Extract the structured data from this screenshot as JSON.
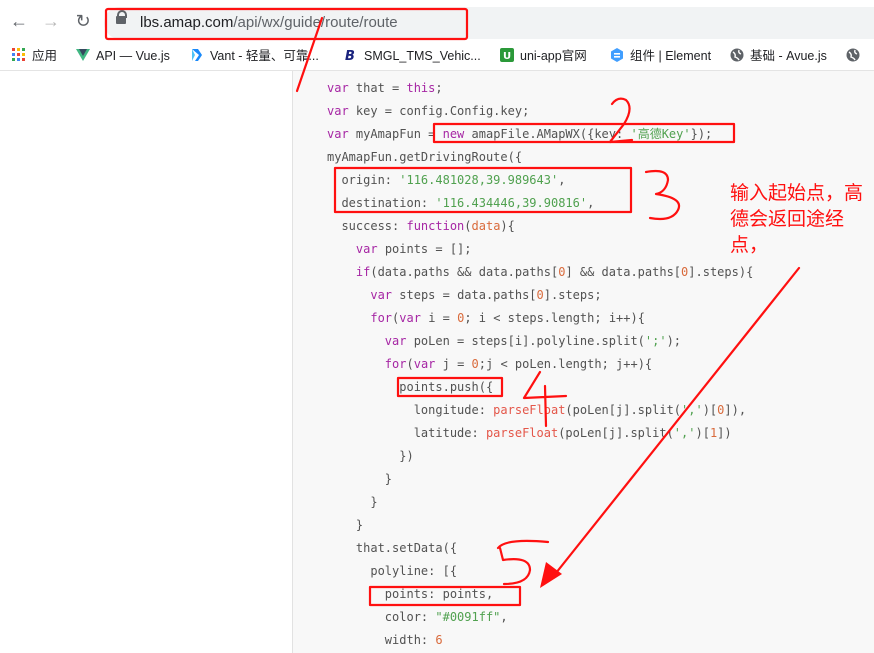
{
  "browser": {
    "url_host": "lbs.amap.com",
    "url_path": "/api/wx/guide/route/route"
  },
  "bookmarks": [
    {
      "label": "应用",
      "icon": "apps-grid-icon"
    },
    {
      "label": "API — Vue.js",
      "icon": "vue-logo-icon"
    },
    {
      "label": "Vant - 轻量、可靠...",
      "icon": "vant-logo-icon"
    },
    {
      "label": "SMGL_TMS_Vehic...",
      "icon": "b-logo-icon"
    },
    {
      "label": "uni-app官网",
      "icon": "uniapp-logo-icon"
    },
    {
      "label": "组件 | Element",
      "icon": "element-logo-icon"
    },
    {
      "label": "基础 - Avue.js",
      "icon": "globe-icon"
    }
  ],
  "code": [
    [
      [
        "k",
        "var "
      ],
      [
        "p",
        "that = "
      ],
      [
        "k",
        "this"
      ],
      [
        "p",
        ";"
      ]
    ],
    [
      [
        "k",
        "var "
      ],
      [
        "p",
        "key = config.Config.key;"
      ]
    ],
    [
      [
        "k",
        "var "
      ],
      [
        "p",
        "myAmapFun = "
      ],
      [
        "k",
        "new "
      ],
      [
        "p",
        "amapFile.AMapWX({key: "
      ],
      [
        "s",
        "'高德Key'"
      ],
      [
        "p",
        "});"
      ]
    ],
    [
      [
        "p",
        "myAmapFun.getDrivingRoute({"
      ]
    ],
    [
      [
        "p",
        "  origin: "
      ],
      [
        "s",
        "'116.481028,39.989643'"
      ],
      [
        "p",
        ","
      ]
    ],
    [
      [
        "p",
        "  destination: "
      ],
      [
        "s",
        "'116.434446,39.90816'"
      ],
      [
        "p",
        ","
      ]
    ],
    [
      [
        "p",
        "  success: "
      ],
      [
        "k",
        "function"
      ],
      [
        "p",
        "("
      ],
      [
        "n",
        "data"
      ],
      [
        "p",
        "){"
      ]
    ],
    [
      [
        "p",
        "    "
      ],
      [
        "k",
        "var "
      ],
      [
        "p",
        "points = [];"
      ]
    ],
    [
      [
        "p",
        "    "
      ],
      [
        "k",
        "if"
      ],
      [
        "p",
        "(data.paths && data.paths["
      ],
      [
        "n",
        "0"
      ],
      [
        "p",
        "] && data.paths["
      ],
      [
        "n",
        "0"
      ],
      [
        "p",
        "].steps){"
      ]
    ],
    [
      [
        "p",
        "      "
      ],
      [
        "k",
        "var "
      ],
      [
        "p",
        "steps = data.paths["
      ],
      [
        "n",
        "0"
      ],
      [
        "p",
        "].steps;"
      ]
    ],
    [
      [
        "p",
        "      "
      ],
      [
        "k",
        "for"
      ],
      [
        "p",
        "("
      ],
      [
        "k",
        "var "
      ],
      [
        "p",
        "i = "
      ],
      [
        "n",
        "0"
      ],
      [
        "p",
        "; i < steps.length; i++){"
      ]
    ],
    [
      [
        "p",
        "        "
      ],
      [
        "k",
        "var "
      ],
      [
        "p",
        "poLen = steps[i].polyline.split("
      ],
      [
        "s",
        "';'"
      ],
      [
        "p",
        ");"
      ]
    ],
    [
      [
        "p",
        "        "
      ],
      [
        "k",
        "for"
      ],
      [
        "p",
        "("
      ],
      [
        "k",
        "var "
      ],
      [
        "p",
        "j = "
      ],
      [
        "n",
        "0"
      ],
      [
        "p",
        ";j < poLen.length; j++){"
      ]
    ],
    [
      [
        "p",
        "          points.push({"
      ]
    ],
    [
      [
        "p",
        "            longitude: "
      ],
      [
        "f",
        "parseFloat"
      ],
      [
        "p",
        "(poLen[j].split("
      ],
      [
        "s",
        "','"
      ],
      [
        "p",
        ")["
      ],
      [
        "n",
        "0"
      ],
      [
        "p",
        "]),"
      ]
    ],
    [
      [
        "p",
        "            latitude: "
      ],
      [
        "f",
        "parseFloat"
      ],
      [
        "p",
        "(poLen[j].split("
      ],
      [
        "s",
        "','"
      ],
      [
        "p",
        ")["
      ],
      [
        "n",
        "1"
      ],
      [
        "p",
        "])"
      ]
    ],
    [
      [
        "p",
        "          })"
      ]
    ],
    [
      [
        "p",
        "        }"
      ]
    ],
    [
      [
        "p",
        "      }"
      ]
    ],
    [
      [
        "p",
        "    }"
      ]
    ],
    [
      [
        "p",
        "    that.setData({"
      ]
    ],
    [
      [
        "p",
        "      polyline: [{"
      ]
    ],
    [
      [
        "p",
        "        points: points,"
      ]
    ],
    [
      [
        "p",
        "        color: "
      ],
      [
        "s",
        "\"#0091ff\""
      ],
      [
        "p",
        ","
      ]
    ],
    [
      [
        "p",
        "        width: "
      ],
      [
        "n",
        "6"
      ]
    ]
  ],
  "annotation": {
    "note": "输入起始点，高德会返回途经点，",
    "color": "#ff1010",
    "numbers": [
      "1",
      "2",
      "3",
      "4",
      "5"
    ]
  }
}
